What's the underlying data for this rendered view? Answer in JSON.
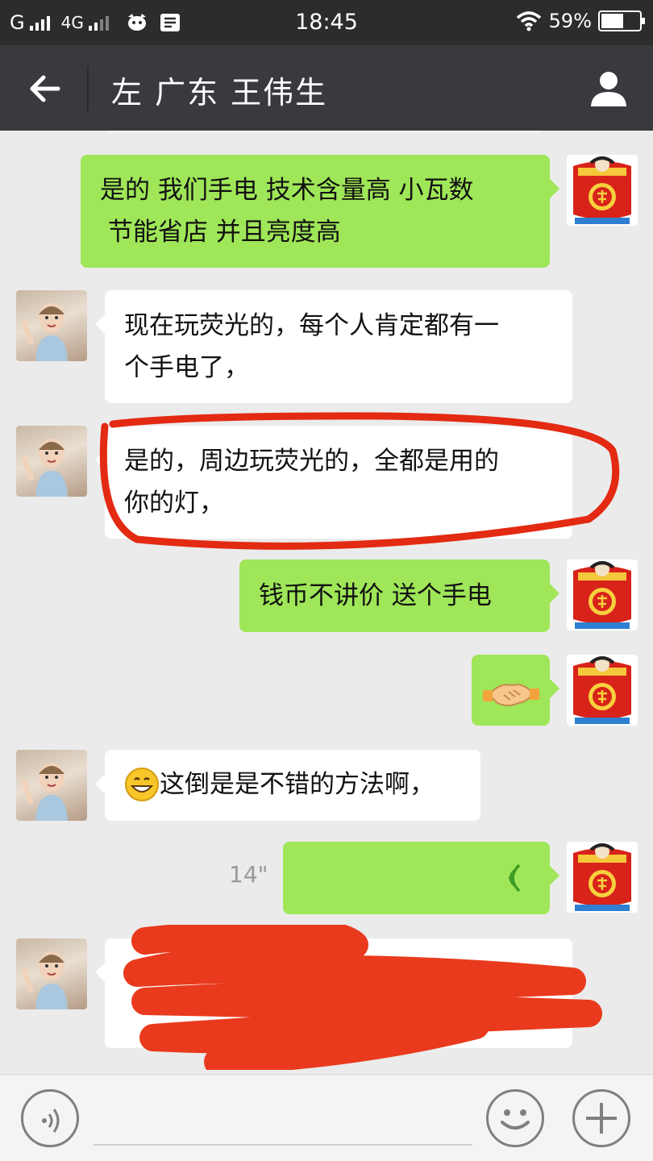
{
  "status_bar": {
    "carrier1": "G",
    "carrier2": "4G",
    "time": "18:45",
    "battery_text": "59%",
    "battery_level": 0.59
  },
  "header": {
    "title": "左 广东 王伟生",
    "back_icon": "arrow-left-icon",
    "profile_icon": "person-icon"
  },
  "messages": [
    {
      "side": "out",
      "text_line1": "是的 我们手电 技术含量高 小瓦数",
      "text_line2": " 节能省店 并且亮度高"
    },
    {
      "side": "in",
      "text_line1": "现在玩荧光的，每个人肯定都有一",
      "text_line2": "个手电了，"
    },
    {
      "side": "in",
      "text_line1": "是的，周边玩荧光的，全都是用的",
      "text_line2": "你的灯，",
      "annotation": "red-circle-highlight"
    },
    {
      "side": "out",
      "text": "钱币不讲价 送个手电"
    },
    {
      "side": "out",
      "emoji": "handshake-emoji"
    },
    {
      "side": "in",
      "emoji": "grinning-emoji",
      "text": "这倒是是不错的方法啊，"
    },
    {
      "side": "out",
      "type": "voice",
      "duration": "14\""
    },
    {
      "side": "in",
      "type": "redacted"
    }
  ],
  "colors": {
    "out_bubble": "#9fe658",
    "in_bubble": "#ffffff",
    "annotation_red": "#e32a12",
    "header_bg": "#393a3f"
  },
  "input_bar": {
    "voice_icon": "voice-toggle-icon",
    "emoji_icon": "emoji-icon",
    "plus_icon": "plus-icon"
  }
}
